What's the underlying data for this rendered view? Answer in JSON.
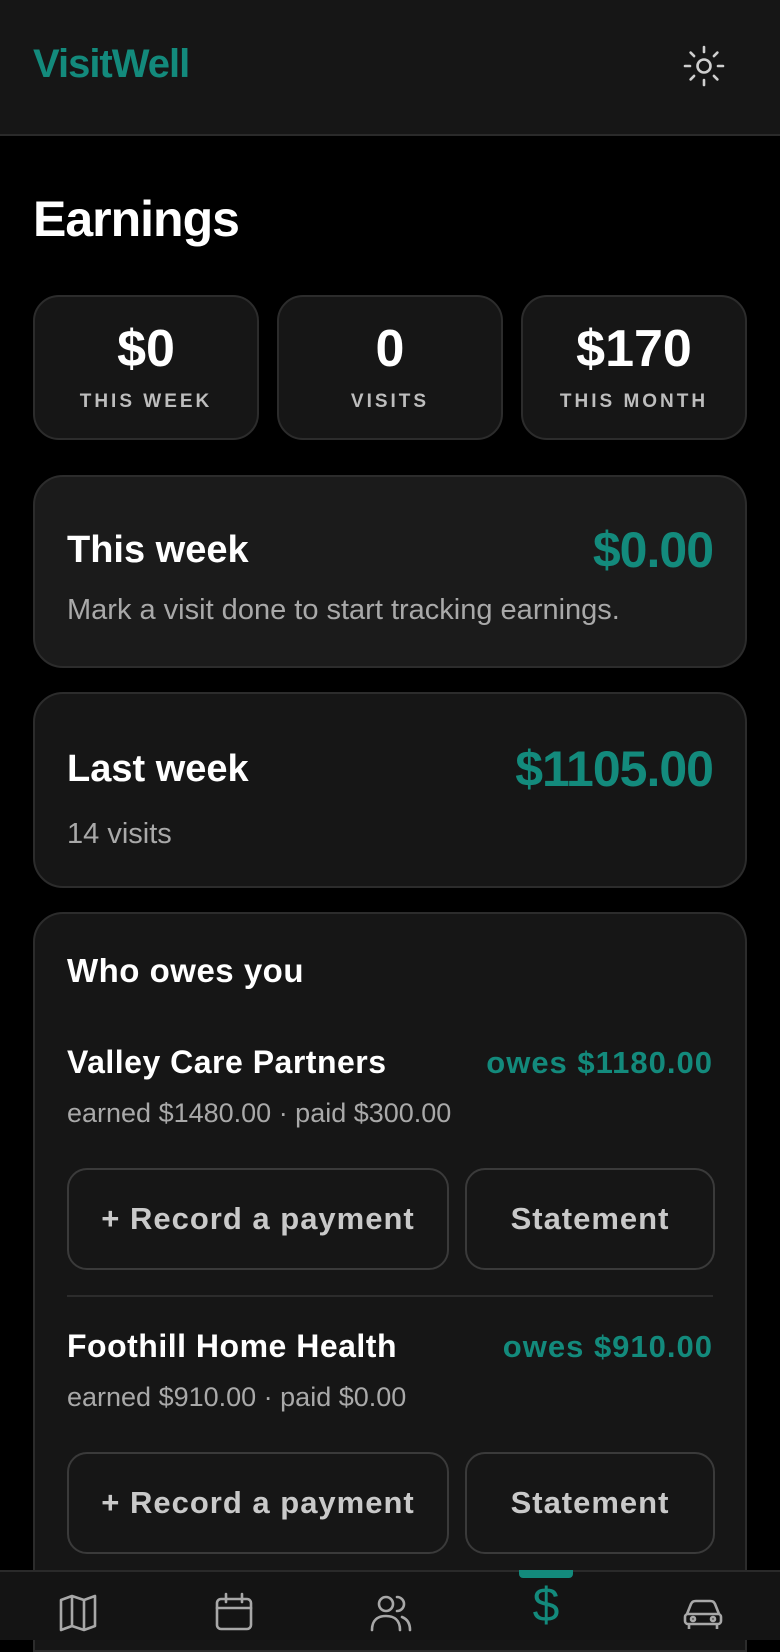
{
  "app": {
    "title": "VisitWell"
  },
  "page": {
    "title": "Earnings"
  },
  "stats": [
    {
      "value": "$0",
      "label": "THIS WEEK"
    },
    {
      "value": "0",
      "label": "VISITS"
    },
    {
      "value": "$170",
      "label": "THIS MONTH"
    }
  ],
  "this_week": {
    "title": "This week",
    "amount": "$0.00",
    "subtitle": "Mark a visit done to start tracking earnings."
  },
  "last_week": {
    "title": "Last week",
    "amount": "$1105.00",
    "subtitle": "14 visits"
  },
  "owes": {
    "heading": "Who owes you",
    "clients": [
      {
        "name": "Valley Care Partners",
        "owes": "owes $1180.00",
        "detail": "earned $1480.00 · paid $300.00",
        "record_label": "+ Record a payment",
        "statement_label": "Statement"
      },
      {
        "name": "Foothill Home Health",
        "owes": "owes $910.00",
        "detail": "earned $910.00 · paid $0.00",
        "record_label": "+ Record a payment",
        "statement_label": "Statement"
      }
    ]
  },
  "nav": {
    "items": [
      {
        "icon": "map-icon"
      },
      {
        "icon": "calendar-icon"
      },
      {
        "icon": "users-icon"
      },
      {
        "icon": "dollar-icon",
        "label": "$",
        "active": true
      },
      {
        "icon": "car-icon"
      }
    ]
  },
  "colors": {
    "accent": "#138a7c",
    "background": "#000000",
    "card": "#161616"
  }
}
